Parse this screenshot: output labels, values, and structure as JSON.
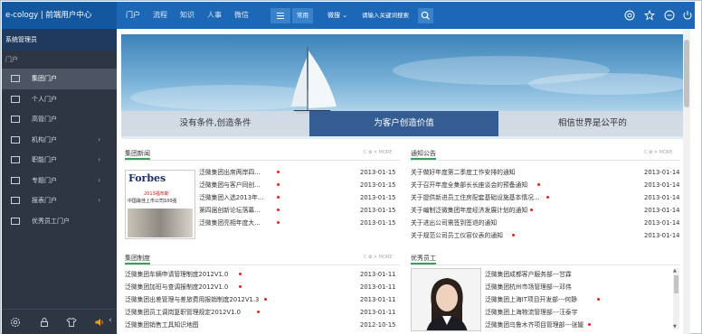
{
  "brand": "e-cology | 前端用户中心",
  "nav": [
    "门户",
    "流程",
    "知识",
    "人事",
    "微信"
  ],
  "common_label": "常用",
  "search": {
    "scope": "微搜",
    "placeholder": "请输入关键词搜索"
  },
  "sidebar": {
    "user": "系统管理员",
    "section": "门户",
    "items": [
      {
        "label": "集团门户",
        "chevron": false,
        "active": true
      },
      {
        "label": "个人门户",
        "chevron": false
      },
      {
        "label": "高管门户",
        "chevron": false
      },
      {
        "label": "机构门户",
        "chevron": true
      },
      {
        "label": "职能门户",
        "chevron": true
      },
      {
        "label": "专题门户",
        "chevron": true
      },
      {
        "label": "报表门户",
        "chevron": true
      },
      {
        "label": "优秀员工门户",
        "chevron": false
      }
    ]
  },
  "banner_tabs": [
    "没有条件,创造条件",
    "为客户创造价值",
    "相信世界是公平的"
  ],
  "panel_tools": "C ✿ ✕ MORE",
  "group_news": {
    "title": "集团新闻",
    "image_text": {
      "logo": "Forbes",
      "line1": "2013福布斯",
      "line2": "中国最佳上市公司100强"
    },
    "rows": [
      {
        "title": "泛微集团出席两岸四...",
        "date": "2013-01-15"
      },
      {
        "title": "泛微集团与客户同创...",
        "date": "2013-01-15"
      },
      {
        "title": "泛微集团入选2013年...",
        "date": "2013-01-15"
      },
      {
        "title": "第四届创新论坛落幕...",
        "date": "2013-01-15"
      },
      {
        "title": "泛微集团亮相年度大...",
        "date": "2013-01-15"
      }
    ]
  },
  "notices": {
    "title": "通知公告",
    "rows": [
      {
        "title": "关于做好年度第二季度工作安排的通知",
        "date": "2013-01-14",
        "dot": false
      },
      {
        "title": "关于召开年度全集部长长座谈会的预备通知",
        "date": "2013-01-14",
        "dot": true
      },
      {
        "title": "关于提供新进员工住房配套基础设施基本情况...",
        "date": "2013-01-14",
        "dot": true
      },
      {
        "title": "关于编制泛微集团年度经济发展计划的通知",
        "date": "2013-01-14",
        "dot": true
      },
      {
        "title": "关于进出公司需签到签退的通知",
        "date": "2013-01-14",
        "dot": false
      },
      {
        "title": "关于规范公司员工仪容仪表的通知",
        "date": "2013-01-14",
        "dot": true
      }
    ]
  },
  "regulations": {
    "title": "集团制度",
    "rows": [
      {
        "title": "泛微集团车辆申请管理制度2012V1.0",
        "date": "2013-01-11"
      },
      {
        "title": "泛微集团加班与查调报制度2012V1.0",
        "date": "2013-01-11"
      },
      {
        "title": "泛微集团出差管理与差旅费用报销制度2012V1.3",
        "date": "2013-01-11"
      },
      {
        "title": "泛微集团员工调岗复职管理规定2012V1.0",
        "date": "2013-01-11"
      },
      {
        "title": "泛微集团销售工具知识地图",
        "date": "2012-10-15"
      }
    ]
  },
  "staff": {
    "title": "优秀员工",
    "rows": [
      {
        "title": "泛微集团成都客户服务部---甘霖",
        "dot": false
      },
      {
        "title": "泛微集团杭州市场管理部---邓伟",
        "dot": false
      },
      {
        "title": "泛微集团上海IT项目开发部---何静",
        "dot": true
      },
      {
        "title": "泛微集团上海物流管理部---汪泰宇",
        "dot": false
      },
      {
        "title": "泛微集团乌鲁木齐项目管理部---张媛",
        "dot": true
      }
    ]
  },
  "colors": {
    "topbar": "#1c67b6",
    "sidebar": "#2e3644",
    "accent_green": "#3a9d5d",
    "active_tab": "#355d93",
    "dot": "#e52222"
  }
}
